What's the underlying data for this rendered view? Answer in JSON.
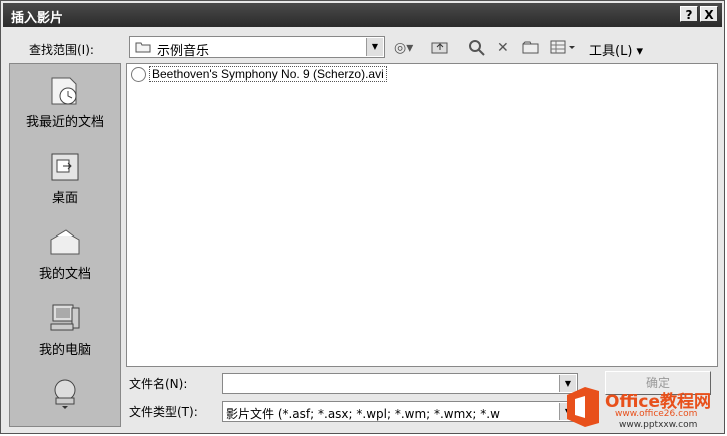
{
  "window": {
    "title": "插入影片",
    "help_label": "?",
    "close_label": "X"
  },
  "toolbar": {
    "lookin_label": "查找范围(I):",
    "lookin_value": "示例音乐",
    "tools_label": "工具(L)"
  },
  "places": [
    {
      "label": "我最近的文档",
      "icon": "recent-documents-icon"
    },
    {
      "label": "桌面",
      "icon": "desktop-icon"
    },
    {
      "label": "我的文档",
      "icon": "my-documents-icon"
    },
    {
      "label": "我的电脑",
      "icon": "my-computer-icon"
    }
  ],
  "files": [
    {
      "name": "Beethoven's Symphony No. 9 (Scherzo).avi"
    }
  ],
  "filename_field": {
    "label": "文件名(N):",
    "value": ""
  },
  "filetype_field": {
    "label": "文件类型(T):",
    "value": "影片文件 (*.asf; *.asx; *.wpl; *.wm; *.wmx; *.w"
  },
  "buttons": {
    "ok_label": "确定"
  },
  "watermark": {
    "brand": "Office教程网",
    "url": "www.office26.com",
    "url2": "www.pptxxw.com"
  }
}
